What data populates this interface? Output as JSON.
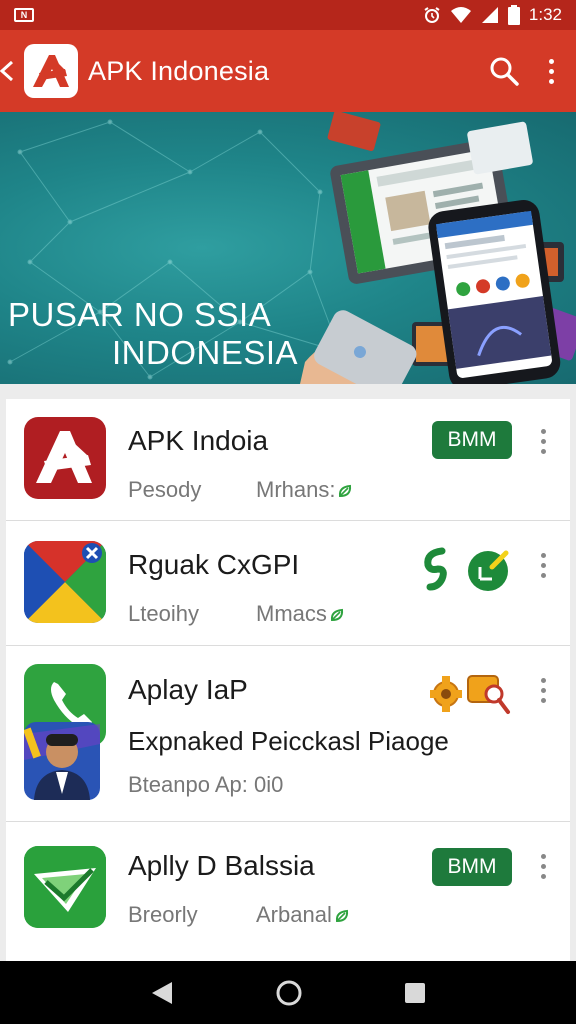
{
  "status_bar": {
    "left_icon_text": "N",
    "time": "1:32"
  },
  "app_bar": {
    "title": "APK Indonesia",
    "icons": [
      "search-icon",
      "more-vert-icon"
    ]
  },
  "banner": {
    "line1": "PUSAR NO SSIA",
    "line2": "INDONESIA"
  },
  "apps": [
    {
      "name": "APK Indoia",
      "meta_left": "Pesody",
      "meta_right": "Mrhans:",
      "badge": "BMM",
      "icon": "apk-logo-icon"
    },
    {
      "name": "Rguak CxGPI",
      "meta_left": "Lteoihy",
      "meta_right": "Mmacs",
      "icon": "play-store-icon",
      "action_icons": [
        "green-leaf-icon",
        "green-edit-icon"
      ]
    },
    {
      "name": "Aplay IaP",
      "subtitle": "Expnaked Peicckasl Piaoge",
      "meta_left": "Bteanpo Ap: 0i0",
      "icon": "phone-icon",
      "action_icons": [
        "orange-gear-icon",
        "orange-key-icon"
      ]
    },
    {
      "name": "Aplly D Balssia",
      "meta_left": "Breorly",
      "meta_right": "Arbanal",
      "badge": "BMM",
      "icon": "green-check-icon"
    }
  ],
  "colors": {
    "app_bar": "#d43a27",
    "status_bar": "#b5261b",
    "badge": "#1e7a3c",
    "accent_green": "#2fa33f"
  }
}
